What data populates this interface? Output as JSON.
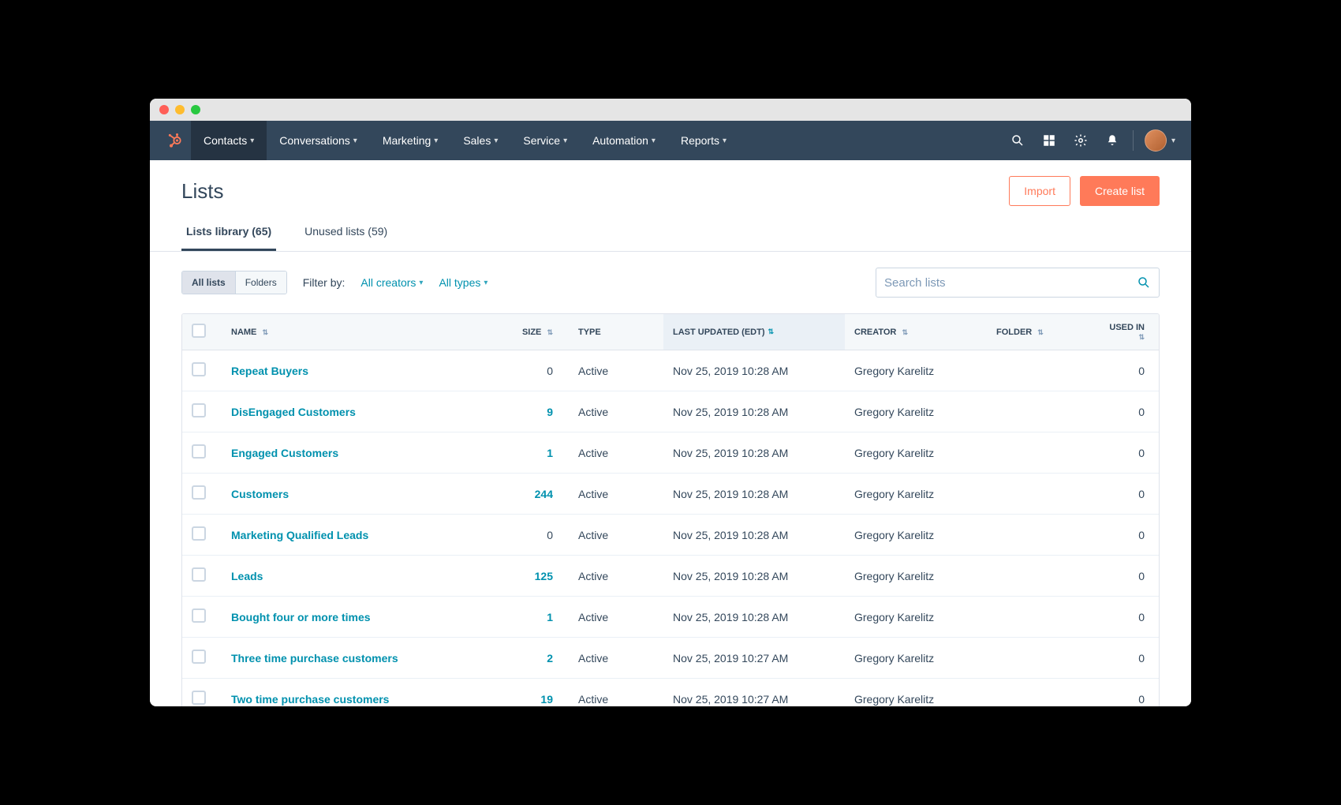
{
  "nav": {
    "items": [
      "Contacts",
      "Conversations",
      "Marketing",
      "Sales",
      "Service",
      "Automation",
      "Reports"
    ]
  },
  "page": {
    "title": "Lists",
    "import_label": "Import",
    "create_label": "Create list"
  },
  "tabs": [
    {
      "label": "Lists library (65)"
    },
    {
      "label": "Unused lists (59)"
    }
  ],
  "segments": {
    "all_lists": "All lists",
    "folders": "Folders"
  },
  "filters": {
    "label": "Filter by:",
    "creators": "All creators",
    "types": "All types"
  },
  "search": {
    "placeholder": "Search lists"
  },
  "columns": {
    "name": "NAME",
    "size": "SIZE",
    "type": "TYPE",
    "last_updated": "LAST UPDATED (EDT)",
    "creator": "CREATOR",
    "folder": "FOLDER",
    "used_in": "USED IN"
  },
  "rows": [
    {
      "name": "Repeat Buyers",
      "size": "0",
      "type": "Active",
      "updated": "Nov 25, 2019 10:28 AM",
      "creator": "Gregory Karelitz",
      "folder": "",
      "used_in": "0"
    },
    {
      "name": "DisEngaged Customers",
      "size": "9",
      "type": "Active",
      "updated": "Nov 25, 2019 10:28 AM",
      "creator": "Gregory Karelitz",
      "folder": "",
      "used_in": "0"
    },
    {
      "name": "Engaged Customers",
      "size": "1",
      "type": "Active",
      "updated": "Nov 25, 2019 10:28 AM",
      "creator": "Gregory Karelitz",
      "folder": "",
      "used_in": "0"
    },
    {
      "name": "Customers",
      "size": "244",
      "type": "Active",
      "updated": "Nov 25, 2019 10:28 AM",
      "creator": "Gregory Karelitz",
      "folder": "",
      "used_in": "0"
    },
    {
      "name": "Marketing Qualified Leads",
      "size": "0",
      "type": "Active",
      "updated": "Nov 25, 2019 10:28 AM",
      "creator": "Gregory Karelitz",
      "folder": "",
      "used_in": "0"
    },
    {
      "name": "Leads",
      "size": "125",
      "type": "Active",
      "updated": "Nov 25, 2019 10:28 AM",
      "creator": "Gregory Karelitz",
      "folder": "",
      "used_in": "0"
    },
    {
      "name": "Bought four or more times",
      "size": "1",
      "type": "Active",
      "updated": "Nov 25, 2019 10:28 AM",
      "creator": "Gregory Karelitz",
      "folder": "",
      "used_in": "0"
    },
    {
      "name": "Three time purchase customers",
      "size": "2",
      "type": "Active",
      "updated": "Nov 25, 2019 10:27 AM",
      "creator": "Gregory Karelitz",
      "folder": "",
      "used_in": "0"
    },
    {
      "name": "Two time purchase customers",
      "size": "19",
      "type": "Active",
      "updated": "Nov 25, 2019 10:27 AM",
      "creator": "Gregory Karelitz",
      "folder": "",
      "used_in": "0"
    }
  ]
}
